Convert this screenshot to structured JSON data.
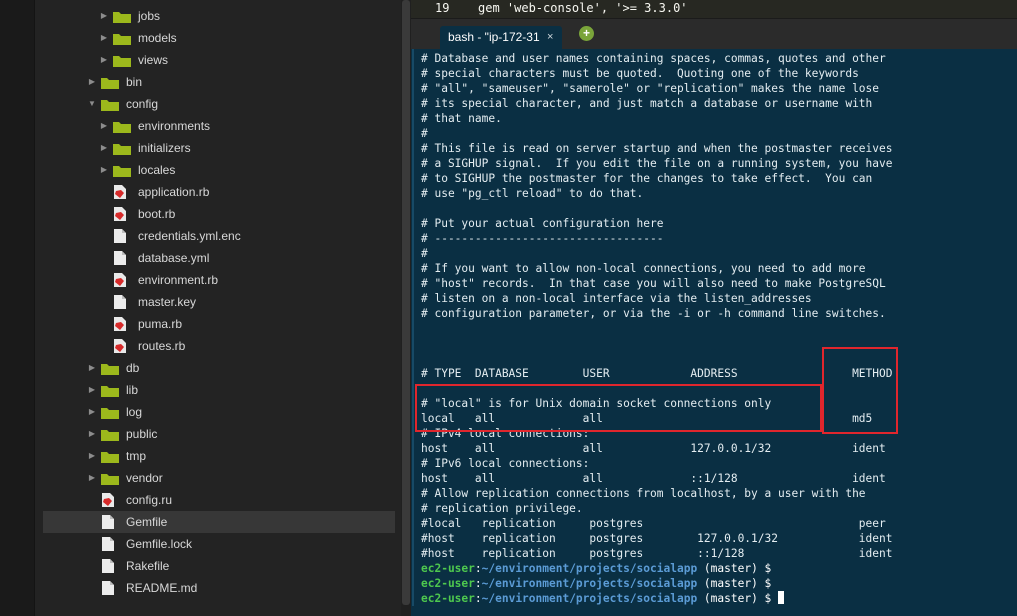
{
  "tree": {
    "items": [
      {
        "kind": "folder",
        "label": "jobs",
        "arrow": "right",
        "depth": 2
      },
      {
        "kind": "folder",
        "label": "models",
        "arrow": "right",
        "depth": 2
      },
      {
        "kind": "folder",
        "label": "views",
        "arrow": "right",
        "depth": 2
      },
      {
        "kind": "folder",
        "label": "bin",
        "arrow": "right",
        "depth": 1
      },
      {
        "kind": "folder",
        "label": "config",
        "arrow": "down",
        "depth": 1
      },
      {
        "kind": "folder",
        "label": "environments",
        "arrow": "right",
        "depth": 2
      },
      {
        "kind": "folder",
        "label": "initializers",
        "arrow": "right",
        "depth": 2
      },
      {
        "kind": "folder",
        "label": "locales",
        "arrow": "right",
        "depth": 2
      },
      {
        "kind": "ruby",
        "label": "application.rb",
        "depth": 2
      },
      {
        "kind": "ruby",
        "label": "boot.rb",
        "depth": 2
      },
      {
        "kind": "file",
        "label": "credentials.yml.enc",
        "depth": 2
      },
      {
        "kind": "file",
        "label": "database.yml",
        "depth": 2
      },
      {
        "kind": "ruby",
        "label": "environment.rb",
        "depth": 2
      },
      {
        "kind": "file",
        "label": "master.key",
        "depth": 2
      },
      {
        "kind": "ruby",
        "label": "puma.rb",
        "depth": 2
      },
      {
        "kind": "ruby",
        "label": "routes.rb",
        "depth": 2
      },
      {
        "kind": "folder",
        "label": "db",
        "arrow": "right",
        "depth": 1
      },
      {
        "kind": "folder",
        "label": "lib",
        "arrow": "right",
        "depth": 1
      },
      {
        "kind": "folder",
        "label": "log",
        "arrow": "right",
        "depth": 1
      },
      {
        "kind": "folder",
        "label": "public",
        "arrow": "right",
        "depth": 1
      },
      {
        "kind": "folder",
        "label": "tmp",
        "arrow": "right",
        "depth": 1
      },
      {
        "kind": "folder",
        "label": "vendor",
        "arrow": "right",
        "depth": 1
      },
      {
        "kind": "ruby",
        "label": "config.ru",
        "depth": 1
      },
      {
        "kind": "file",
        "label": "Gemfile",
        "depth": 1,
        "selected": true
      },
      {
        "kind": "file",
        "label": "Gemfile.lock",
        "depth": 1
      },
      {
        "kind": "file",
        "label": "Rakefile",
        "depth": 1
      },
      {
        "kind": "file",
        "label": "README.md",
        "depth": 1
      }
    ]
  },
  "editor": {
    "line_number": "19",
    "code": "gem 'web-console', '>= 3.3.0'"
  },
  "tabs": {
    "active_title": "bash - \"ip-172-31",
    "close_glyph": "×",
    "add_glyph": "+"
  },
  "terminal": {
    "lines": [
      "# Database and user names containing spaces, commas, quotes and other",
      "# special characters must be quoted.  Quoting one of the keywords",
      "# \"all\", \"sameuser\", \"samerole\" or \"replication\" makes the name lose",
      "# its special character, and just match a database or username with",
      "# that name.",
      "#",
      "# This file is read on server startup and when the postmaster receives",
      "# a SIGHUP signal.  If you edit the file on a running system, you have",
      "# to SIGHUP the postmaster for the changes to take effect.  You can",
      "# use \"pg_ctl reload\" to do that.",
      "",
      "# Put your actual configuration here",
      "# ----------------------------------",
      "#",
      "# If you want to allow non-local connections, you need to add more",
      "# \"host\" records.  In that case you will also need to make PostgreSQL",
      "# listen on a non-local interface via the listen_addresses",
      "# configuration parameter, or via the -i or -h command line switches.",
      "",
      "",
      "",
      "# TYPE  DATABASE        USER            ADDRESS                 METHOD",
      "",
      "# \"local\" is for Unix domain socket connections only",
      "local   all             all                                     md5",
      "# IPv4 local connections:",
      "host    all             all             127.0.0.1/32            ident",
      "# IPv6 local connections:",
      "host    all             all             ::1/128                 ident",
      "# Allow replication connections from localhost, by a user with the",
      "# replication privilege.",
      "#local   replication     postgres                                peer",
      "#host    replication     postgres        127.0.0.1/32            ident",
      "#host    replication     postgres        ::1/128                 ident"
    ],
    "prompts": [
      {
        "user": "ec2-user",
        "sep": ":",
        "path": "~/environment/projects/socialapp",
        "branch": " (master) $"
      },
      {
        "user": "ec2-user",
        "sep": ":",
        "path": "~/environment/projects/socialapp",
        "branch": " (master) $"
      },
      {
        "user": "ec2-user",
        "sep": ":",
        "path": "~/environment/projects/socialapp",
        "branch": " (master) $ "
      }
    ]
  },
  "colors": {
    "terminal_bg": "#0a2f43",
    "highlight": "#e0262d",
    "folder": "#9cb81c",
    "ruby": "#d72a2a",
    "prompt_user": "#4ec94e",
    "prompt_path": "#5b9bd5"
  }
}
